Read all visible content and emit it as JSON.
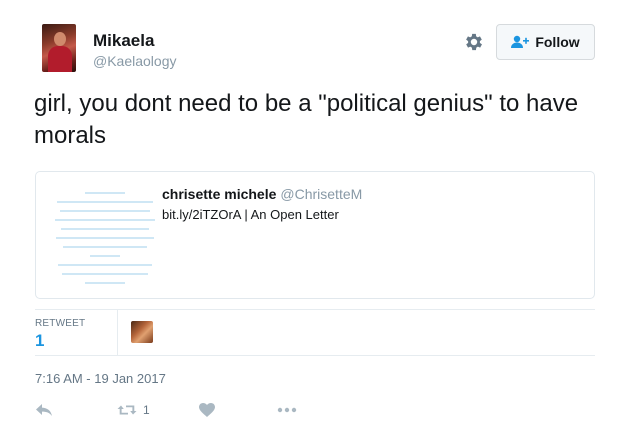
{
  "user": {
    "name": "Mikaela",
    "handle": "@Kaelaology"
  },
  "header": {
    "follow_label": "Follow"
  },
  "tweet": {
    "text": "girl, you dont need to be a \"political genius\" to have morals"
  },
  "card": {
    "author_name": "chrisette michele",
    "author_handle": "@ChrisetteM",
    "link_text": "bit.ly/2iTZOrA | An Open Letter"
  },
  "stats": {
    "retweet_label": "RETWEET",
    "retweet_count": "1"
  },
  "meta": {
    "timestamp": "7:16 AM - 19 Jan 2017"
  },
  "actions": {
    "retweet_count": "1"
  },
  "icons": {
    "settings": "gear-icon",
    "follow": "add-user-icon",
    "reply": "reply-icon",
    "retweet": "retweet-icon",
    "like": "heart-icon",
    "more": "more-icon"
  },
  "colors": {
    "icon_gray": "#aab8c2",
    "link_blue": "#1b95e0",
    "card_thumb_text": "#cfe7f5"
  }
}
